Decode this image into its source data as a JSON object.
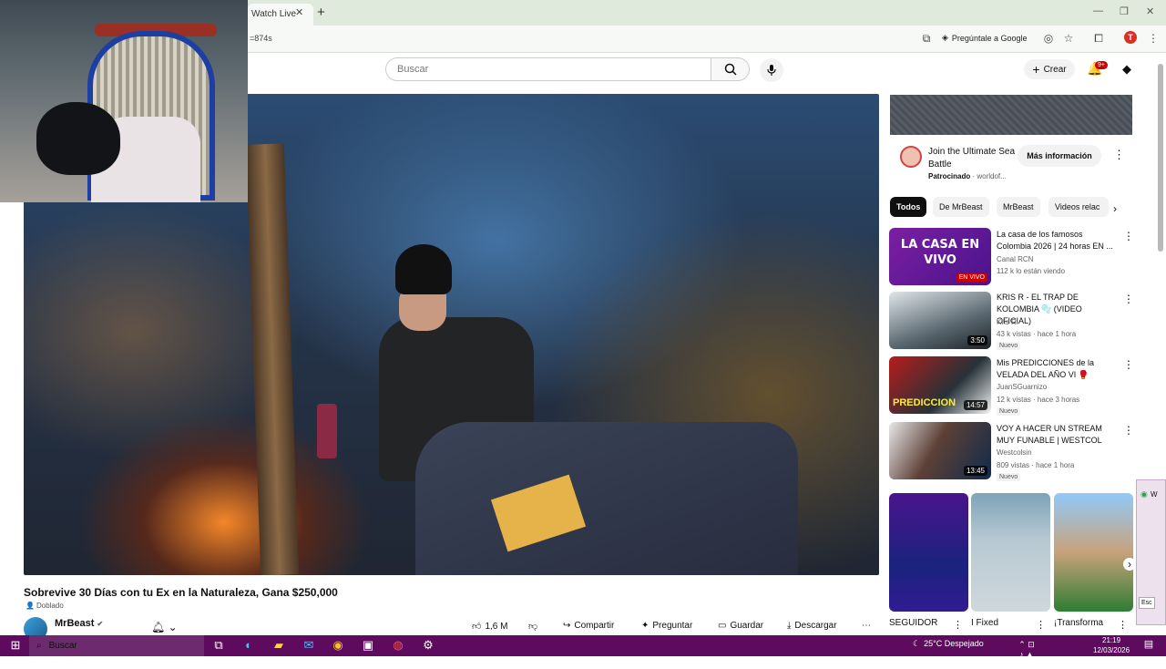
{
  "browser": {
    "tab_title": "Watch Live",
    "url_fragment": "=874s",
    "google_pill": "Pregúntale a Google",
    "profile_initial": "T"
  },
  "yt_header": {
    "search_placeholder": "Buscar",
    "create_label": "Crear",
    "notif_badge": "9+"
  },
  "video": {
    "title": "Sobrevive 30 Días con tu Ex en la Naturaleza, Gana $250,000",
    "dubbed": "Doblado",
    "channel": "MrBeast",
    "actions": {
      "likes": "1,6 M",
      "share": "Compartir",
      "ask": "Preguntar",
      "save": "Guardar",
      "download": "Descargar"
    }
  },
  "sidebar": {
    "ad": {
      "title": "Join the Ultimate Sea Battle",
      "sponsored": "Patrocinado",
      "domain": "worldof...",
      "cta": "Más información"
    },
    "chips": [
      "Todos",
      "De MrBeast",
      "MrBeast",
      "Videos relac"
    ],
    "recommendations": [
      {
        "title": "La casa de los famosos Colombia 2026 | 24 horas EN ...",
        "channel": "Canal RCN",
        "meta": "112 k lo están viendo",
        "thumb_text": "LA CASA EN VIVO",
        "live_label": "EN VIVO",
        "badge": "",
        "duration": ""
      },
      {
        "title": "KRIS R - EL TRAP DE KOLOMBIA 🫧 (VIDEO OFICIAL)",
        "channel": "Kris R.",
        "meta": "43 k vistas · hace 1 hora",
        "thumb_text": "",
        "live_label": "",
        "badge": "Nuevo",
        "duration": "3:50"
      },
      {
        "title": "Mis PREDICCIONES de la VELADA DEL AÑO VI 🥊",
        "channel": "JuanSGuarnizo",
        "meta": "12 k vistas · hace 3 horas",
        "thumb_text": "PREDICCION",
        "live_label": "",
        "badge": "Nuevo",
        "duration": "14:57"
      },
      {
        "title": "VOY A HACER UN STREAM MUY FUNABLE | WESTCOL",
        "channel": "Westcolsin",
        "meta": "809 vistas · hace 1 hora",
        "thumb_text": "",
        "live_label": "",
        "badge": "Nuevo",
        "duration": "13:45"
      }
    ],
    "shorts": [
      {
        "title": "SEGUIDOR"
      },
      {
        "title": "I Fixed"
      },
      {
        "title": "¡Transforma"
      }
    ],
    "wa_label": "W",
    "wa_btn": "Esc"
  },
  "taskbar": {
    "search": "Buscar",
    "weather": "25°C  Despejado",
    "time": "21:19",
    "date": "12/03/2026"
  },
  "colors": {
    "taskbar": "#5e0a5e",
    "youtube_red": "#cc0000"
  }
}
